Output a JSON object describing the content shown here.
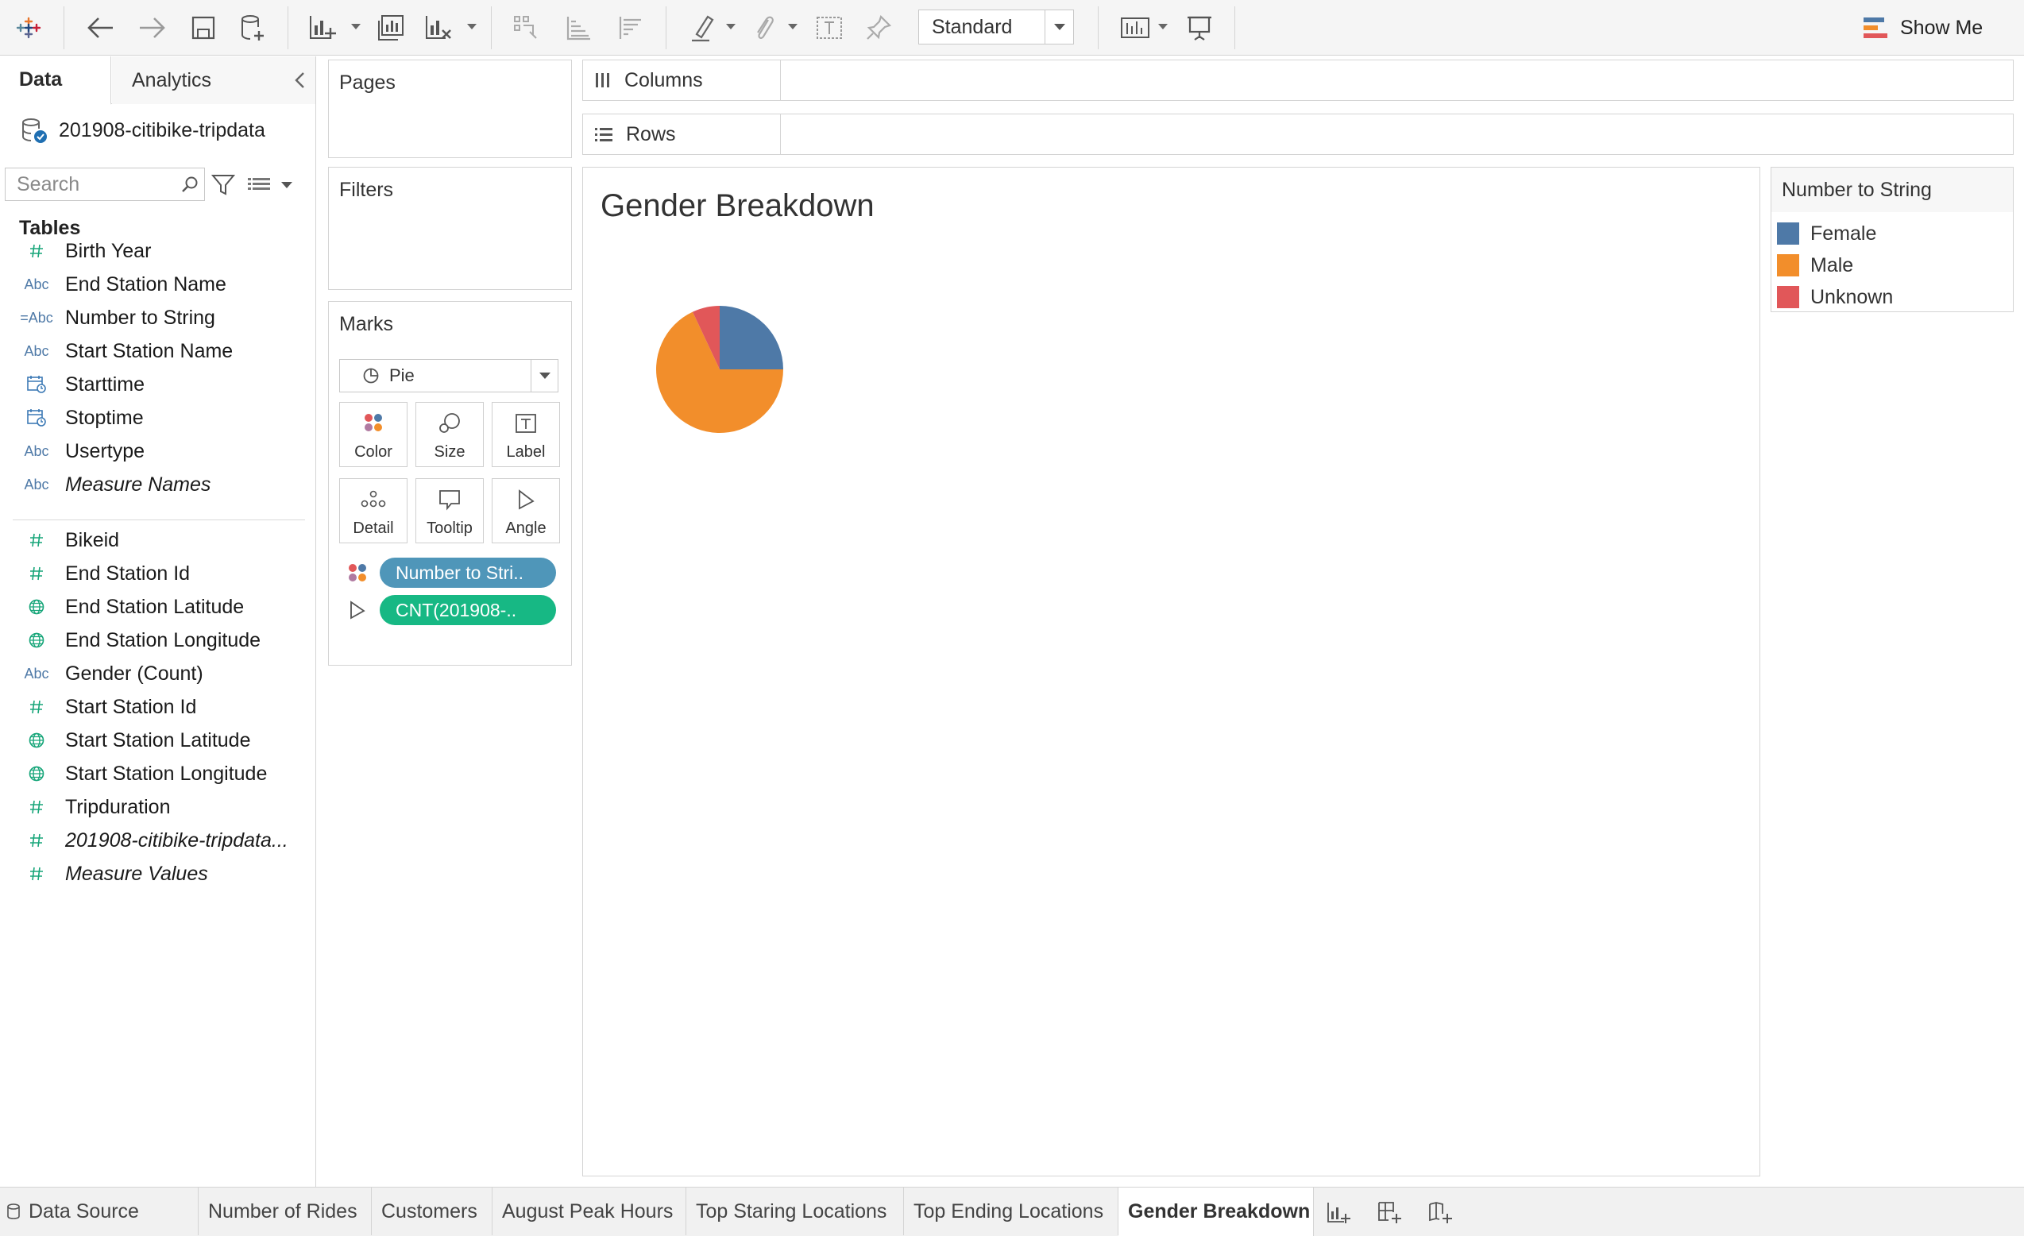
{
  "toolbar": {
    "mark_type_select": "Standard",
    "show_me_label": "Show Me"
  },
  "data_pane": {
    "tabs": [
      {
        "label": "Data"
      },
      {
        "label": "Analytics"
      }
    ],
    "datasource_name": "201908-citibike-tripdata",
    "search_placeholder": "Search",
    "tables_header": "Tables",
    "fields": [
      {
        "icon": "#",
        "name": "Birth Year"
      },
      {
        "icon": "Abc",
        "name": "End Station Name"
      },
      {
        "icon": "=Abc",
        "name": "Number to String"
      },
      {
        "icon": "Abc",
        "name": "Start Station Name"
      },
      {
        "icon": "calendar-icon",
        "name": "Starttime"
      },
      {
        "icon": "calendar-icon",
        "name": "Stoptime"
      },
      {
        "icon": "Abc",
        "name": "Usertype"
      },
      {
        "icon": "Abc",
        "name": "Measure Names"
      },
      {
        "icon": "#",
        "name": "Bikeid"
      },
      {
        "icon": "#",
        "name": "End Station Id"
      },
      {
        "icon": "globe-icon",
        "name": "End Station Latitude"
      },
      {
        "icon": "globe-icon",
        "name": "End Station Longitude"
      },
      {
        "icon": "Abc",
        "name": "Gender (Count)"
      },
      {
        "icon": "#",
        "name": "Start Station Id"
      },
      {
        "icon": "globe-icon",
        "name": "Start Station Latitude"
      },
      {
        "icon": "globe-icon",
        "name": "Start Station Longitude"
      },
      {
        "icon": "#",
        "name": "Tripduration"
      },
      {
        "icon": "#",
        "name": "201908-citibike-tripdata..."
      },
      {
        "icon": "#",
        "name": "Measure Values"
      }
    ]
  },
  "shelves": {
    "pages_label": "Pages",
    "filters_label": "Filters",
    "columns_label": "Columns",
    "rows_label": "Rows"
  },
  "marks": {
    "title": "Marks",
    "mark_type": "Pie",
    "buttons": [
      {
        "label": "Color"
      },
      {
        "label": "Size"
      },
      {
        "label": "Label"
      },
      {
        "label": "Detail"
      },
      {
        "label": "Tooltip"
      },
      {
        "label": "Angle"
      }
    ],
    "pills": [
      {
        "label": "Number to Stri..",
        "role": "color"
      },
      {
        "label": "CNT(201908-..",
        "role": "angle"
      }
    ]
  },
  "view": {
    "title": "Gender Breakdown"
  },
  "legend": {
    "title": "Number to String",
    "items": [
      {
        "label": "Female",
        "color": "#4e79a7"
      },
      {
        "label": "Male",
        "color": "#f28e2b"
      },
      {
        "label": "Unknown",
        "color": "#e15759"
      }
    ]
  },
  "chart_data": {
    "type": "pie",
    "title": "Gender Breakdown",
    "categories": [
      "Female",
      "Male",
      "Unknown"
    ],
    "values": [
      25,
      68,
      7
    ],
    "colors": [
      "#4e79a7",
      "#f28e2b",
      "#e15759"
    ]
  },
  "sheet_tabs": [
    {
      "label": "Data Source"
    },
    {
      "label": "Number of Rides"
    },
    {
      "label": "Customers"
    },
    {
      "label": "August Peak Hours"
    },
    {
      "label": "Top Staring Locations"
    },
    {
      "label": "Top Ending Locations"
    },
    {
      "label": "Gender Breakdown",
      "active": true
    }
  ]
}
